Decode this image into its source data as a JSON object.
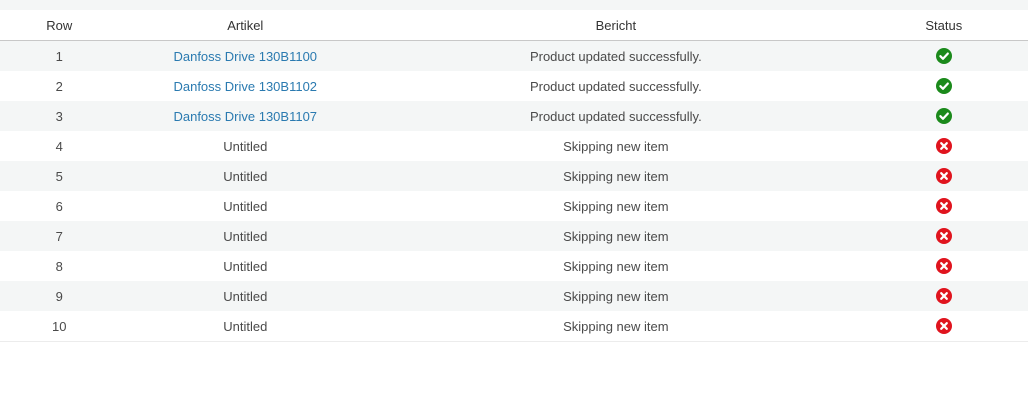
{
  "table": {
    "headers": {
      "row": "Row",
      "artikel": "Artikel",
      "bericht": "Bericht",
      "status": "Status"
    },
    "rows": [
      {
        "row": "1",
        "artikel": "Danfoss Drive 130B1100",
        "link": true,
        "bericht": "Product updated successfully.",
        "status": "success"
      },
      {
        "row": "2",
        "artikel": "Danfoss Drive 130B1102",
        "link": true,
        "bericht": "Product updated successfully.",
        "status": "success"
      },
      {
        "row": "3",
        "artikel": "Danfoss Drive 130B1107",
        "link": true,
        "bericht": "Product updated successfully.",
        "status": "success"
      },
      {
        "row": "4",
        "artikel": "Untitled",
        "link": false,
        "bericht": "Skipping new item",
        "status": "error"
      },
      {
        "row": "5",
        "artikel": "Untitled",
        "link": false,
        "bericht": "Skipping new item",
        "status": "error"
      },
      {
        "row": "6",
        "artikel": "Untitled",
        "link": false,
        "bericht": "Skipping new item",
        "status": "error"
      },
      {
        "row": "7",
        "artikel": "Untitled",
        "link": false,
        "bericht": "Skipping new item",
        "status": "error"
      },
      {
        "row": "8",
        "artikel": "Untitled",
        "link": false,
        "bericht": "Skipping new item",
        "status": "error"
      },
      {
        "row": "9",
        "artikel": "Untitled",
        "link": false,
        "bericht": "Skipping new item",
        "status": "error"
      },
      {
        "row": "10",
        "artikel": "Untitled",
        "link": false,
        "bericht": "Skipping new item",
        "status": "error"
      }
    ]
  },
  "colors": {
    "success": "#1b8a1b",
    "error": "#e0141e",
    "link": "#2a7ab0"
  },
  "icons": {
    "success": "check-circle-icon",
    "error": "x-circle-icon"
  }
}
